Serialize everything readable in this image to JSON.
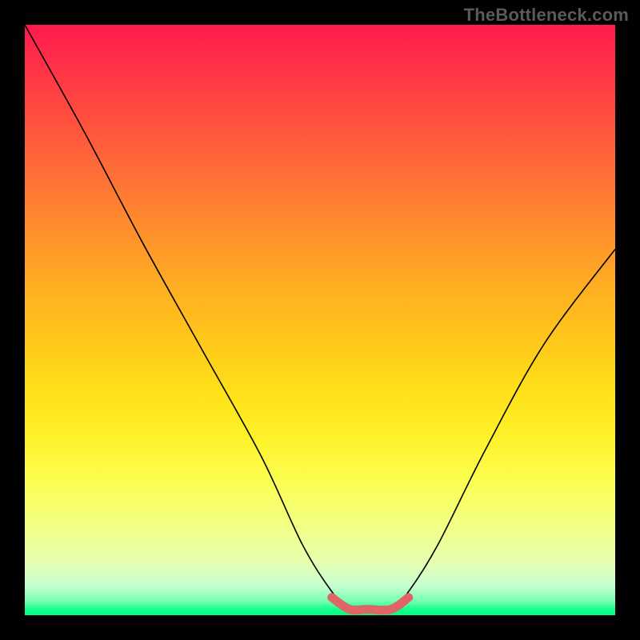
{
  "watermark": "TheBottleneck.com",
  "chart_data": {
    "type": "line",
    "title": "",
    "xlabel": "",
    "ylabel": "",
    "xlim": [
      0,
      100
    ],
    "ylim": [
      0,
      100
    ],
    "series": [
      {
        "name": "bottleneck-curve",
        "x": [
          0,
          10,
          20,
          30,
          40,
          47,
          52,
          55,
          58,
          62,
          65,
          70,
          78,
          88,
          100
        ],
        "values": [
          100,
          82,
          63,
          45,
          27,
          12,
          4,
          1,
          1,
          1,
          4,
          12,
          28,
          46,
          62
        ]
      }
    ],
    "highlight": {
      "name": "optimal-range",
      "x": [
        52,
        55,
        58,
        62,
        65
      ],
      "values": [
        3,
        1,
        1,
        1,
        3
      ]
    },
    "gradient_stops": [
      {
        "pos": 0,
        "color": "#ff1a4d"
      },
      {
        "pos": 0.34,
        "color": "#ff8c2e"
      },
      {
        "pos": 0.62,
        "color": "#ffe019"
      },
      {
        "pos": 0.85,
        "color": "#f2ff86"
      },
      {
        "pos": 1.0,
        "color": "#00ff85"
      }
    ]
  }
}
